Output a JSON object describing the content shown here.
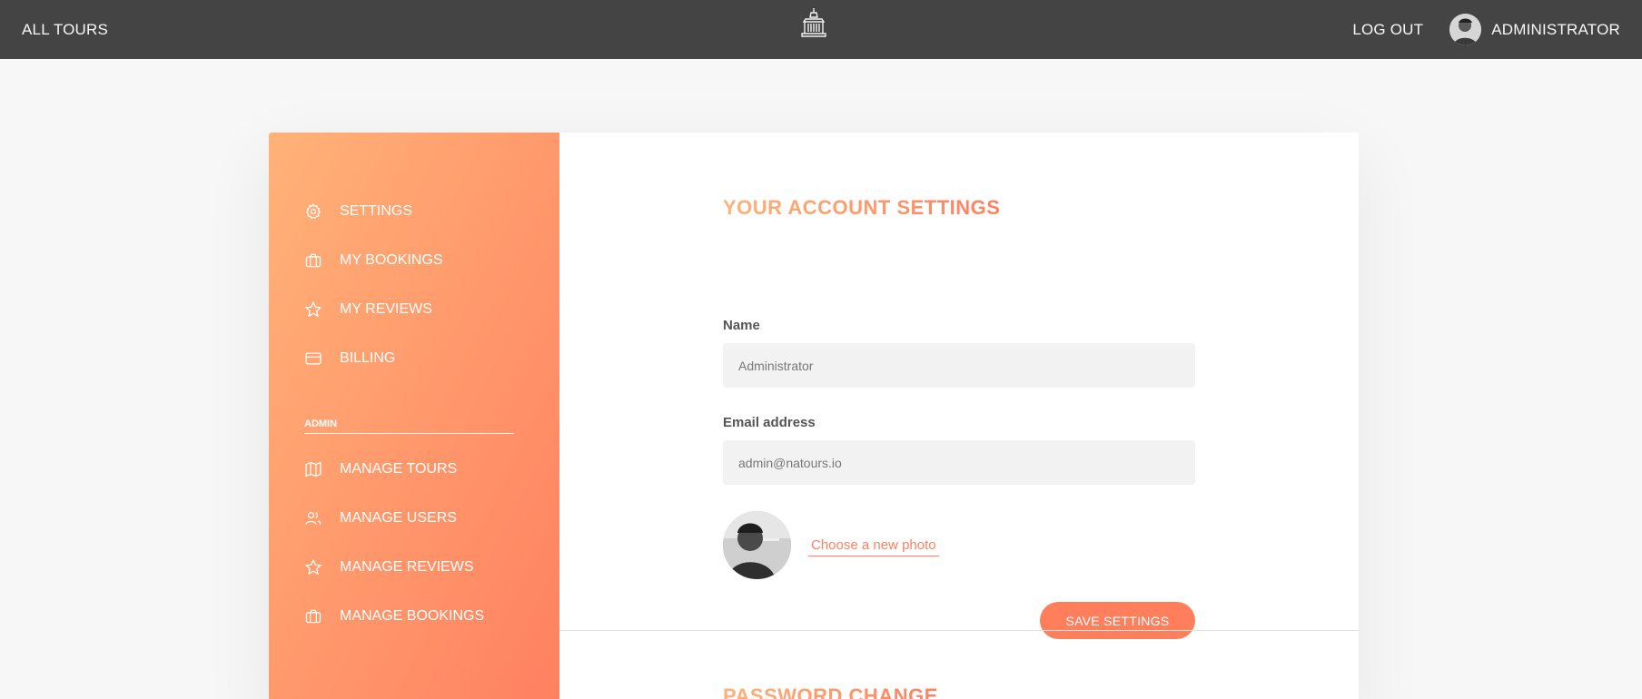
{
  "header": {
    "all_tours": "All tours",
    "logout": "Log out",
    "user_name": "Administrator",
    "logo_icon": "temple-logo-icon"
  },
  "sidebar": {
    "items": [
      {
        "label": "Settings",
        "icon": "gear-icon"
      },
      {
        "label": "My bookings",
        "icon": "briefcase-icon"
      },
      {
        "label": "My reviews",
        "icon": "star-icon"
      },
      {
        "label": "Billing",
        "icon": "credit-card-icon"
      }
    ],
    "admin_title": "Admin",
    "admin_items": [
      {
        "label": "Manage tours",
        "icon": "map-icon"
      },
      {
        "label": "Manage users",
        "icon": "users-icon"
      },
      {
        "label": "Manage reviews",
        "icon": "star-icon"
      },
      {
        "label": "Manage bookings",
        "icon": "briefcase-icon"
      }
    ]
  },
  "account": {
    "title": "Your account settings",
    "name_label": "Name",
    "name_value": "Administrator",
    "email_label": "Email address",
    "email_value": "admin@natours.io",
    "photo_link": "Choose a new photo",
    "save_button": "Save settings"
  },
  "password": {
    "title": "Password change"
  },
  "colors": {
    "header_bg": "#444444",
    "gradient_start": "#ffb278",
    "gradient_end": "#ff8060",
    "accent": "#ff7f5c"
  }
}
